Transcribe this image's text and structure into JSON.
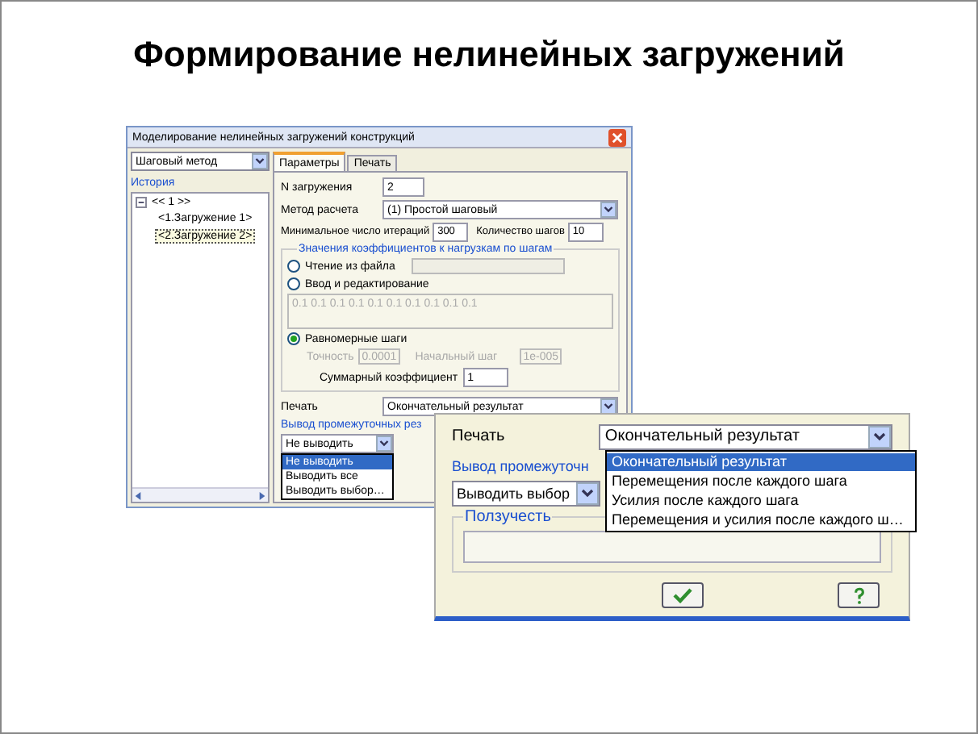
{
  "slide_title": "Формирование нелинейных загружений",
  "dialog": {
    "title": "Моделирование нелинейных загружений конструкций",
    "method_select": {
      "value": "Шаговый метод"
    },
    "history": {
      "label": "История",
      "tree": [
        {
          "label": "<< 1 >>",
          "expanded": true,
          "children": [
            {
              "label": "<1.Загружение 1>",
              "selected": false
            },
            {
              "label": "<2.Загружение 2>",
              "selected": true
            }
          ]
        }
      ]
    },
    "tabs": [
      {
        "label": "Параметры",
        "selected": true
      },
      {
        "label": "Печать",
        "selected": false
      }
    ],
    "n_load": {
      "label": "N загружения",
      "value": "2"
    },
    "calc_method": {
      "label": "Метод расчета",
      "value": "(1) Простой шаговый"
    },
    "min_iterations": {
      "label": "Минимальное число итераций",
      "value": "300"
    },
    "step_count": {
      "label": "Количество шагов",
      "value": "10"
    },
    "coefficients": {
      "legend": "Значения коэффициентов к нагрузкам по шагам",
      "options": [
        {
          "kind": "file",
          "label": "Чтение из файла",
          "selected": false
        },
        {
          "kind": "edit",
          "label": "Ввод и редактирование",
          "selected": false,
          "value": "0.1 0.1 0.1 0.1 0.1 0.1 0.1 0.1 0.1 0.1"
        },
        {
          "kind": "uniform",
          "label": "Равномерные шаги",
          "selected": true
        }
      ],
      "precision": {
        "label": "Точность",
        "value": "0.0001",
        "disabled": true
      },
      "initial_step": {
        "label": "Начальный шаг",
        "value": "1e-005",
        "disabled": true
      },
      "total": {
        "label": "Суммарный коэффициент",
        "value": "1"
      }
    },
    "print": {
      "label": "Печать",
      "value": "Окончательный результат"
    },
    "intermediate": {
      "legend": "Вывод промежуточных рез",
      "value": "Не выводить",
      "expanded": true,
      "options": [
        {
          "label": "Не выводить",
          "selected": true
        },
        {
          "label": "Выводить все",
          "selected": false
        },
        {
          "label": "Выводить выбор…",
          "selected": false
        }
      ]
    }
  },
  "inset": {
    "print": {
      "label": "Печать",
      "value": "Окончательный результат",
      "expanded": true,
      "options": [
        {
          "label": "Окончательный результат",
          "selected": true
        },
        {
          "label": "Перемещения после каждого шага",
          "selected": false
        },
        {
          "label": "Усилия после каждого шага",
          "selected": false
        },
        {
          "label": "Перемещения и усилия после каждого ш…",
          "selected": false
        }
      ]
    },
    "intermediate": {
      "legend": "Вывод промежуточн",
      "value": "Выводить выбор"
    },
    "creep": {
      "legend": "Ползучесть"
    }
  }
}
